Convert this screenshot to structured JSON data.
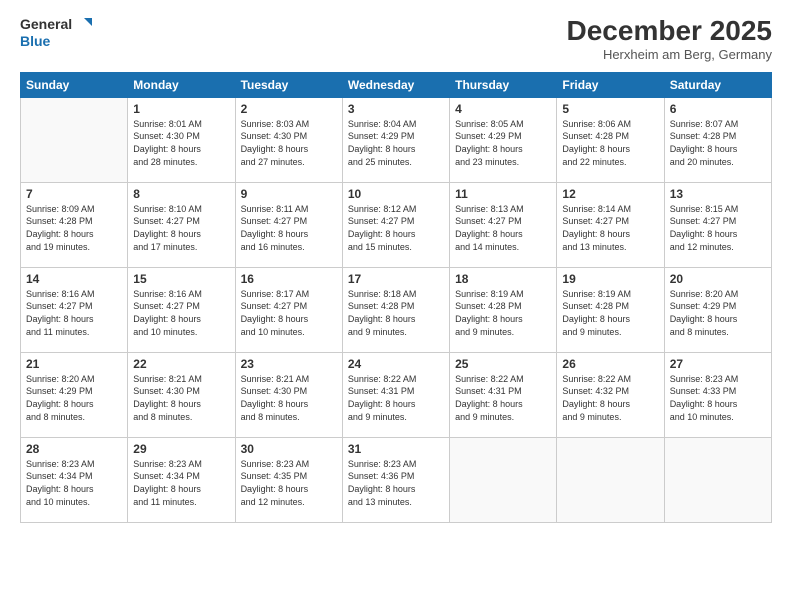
{
  "logo": {
    "general": "General",
    "blue": "Blue"
  },
  "title": "December 2025",
  "location": "Herxheim am Berg, Germany",
  "weekdays": [
    "Sunday",
    "Monday",
    "Tuesday",
    "Wednesday",
    "Thursday",
    "Friday",
    "Saturday"
  ],
  "weeks": [
    [
      {
        "day": "",
        "info": ""
      },
      {
        "day": "1",
        "info": "Sunrise: 8:01 AM\nSunset: 4:30 PM\nDaylight: 8 hours\nand 28 minutes."
      },
      {
        "day": "2",
        "info": "Sunrise: 8:03 AM\nSunset: 4:30 PM\nDaylight: 8 hours\nand 27 minutes."
      },
      {
        "day": "3",
        "info": "Sunrise: 8:04 AM\nSunset: 4:29 PM\nDaylight: 8 hours\nand 25 minutes."
      },
      {
        "day": "4",
        "info": "Sunrise: 8:05 AM\nSunset: 4:29 PM\nDaylight: 8 hours\nand 23 minutes."
      },
      {
        "day": "5",
        "info": "Sunrise: 8:06 AM\nSunset: 4:28 PM\nDaylight: 8 hours\nand 22 minutes."
      },
      {
        "day": "6",
        "info": "Sunrise: 8:07 AM\nSunset: 4:28 PM\nDaylight: 8 hours\nand 20 minutes."
      }
    ],
    [
      {
        "day": "7",
        "info": "Sunrise: 8:09 AM\nSunset: 4:28 PM\nDaylight: 8 hours\nand 19 minutes."
      },
      {
        "day": "8",
        "info": "Sunrise: 8:10 AM\nSunset: 4:27 PM\nDaylight: 8 hours\nand 17 minutes."
      },
      {
        "day": "9",
        "info": "Sunrise: 8:11 AM\nSunset: 4:27 PM\nDaylight: 8 hours\nand 16 minutes."
      },
      {
        "day": "10",
        "info": "Sunrise: 8:12 AM\nSunset: 4:27 PM\nDaylight: 8 hours\nand 15 minutes."
      },
      {
        "day": "11",
        "info": "Sunrise: 8:13 AM\nSunset: 4:27 PM\nDaylight: 8 hours\nand 14 minutes."
      },
      {
        "day": "12",
        "info": "Sunrise: 8:14 AM\nSunset: 4:27 PM\nDaylight: 8 hours\nand 13 minutes."
      },
      {
        "day": "13",
        "info": "Sunrise: 8:15 AM\nSunset: 4:27 PM\nDaylight: 8 hours\nand 12 minutes."
      }
    ],
    [
      {
        "day": "14",
        "info": "Sunrise: 8:16 AM\nSunset: 4:27 PM\nDaylight: 8 hours\nand 11 minutes."
      },
      {
        "day": "15",
        "info": "Sunrise: 8:16 AM\nSunset: 4:27 PM\nDaylight: 8 hours\nand 10 minutes."
      },
      {
        "day": "16",
        "info": "Sunrise: 8:17 AM\nSunset: 4:27 PM\nDaylight: 8 hours\nand 10 minutes."
      },
      {
        "day": "17",
        "info": "Sunrise: 8:18 AM\nSunset: 4:28 PM\nDaylight: 8 hours\nand 9 minutes."
      },
      {
        "day": "18",
        "info": "Sunrise: 8:19 AM\nSunset: 4:28 PM\nDaylight: 8 hours\nand 9 minutes."
      },
      {
        "day": "19",
        "info": "Sunrise: 8:19 AM\nSunset: 4:28 PM\nDaylight: 8 hours\nand 9 minutes."
      },
      {
        "day": "20",
        "info": "Sunrise: 8:20 AM\nSunset: 4:29 PM\nDaylight: 8 hours\nand 8 minutes."
      }
    ],
    [
      {
        "day": "21",
        "info": "Sunrise: 8:20 AM\nSunset: 4:29 PM\nDaylight: 8 hours\nand 8 minutes."
      },
      {
        "day": "22",
        "info": "Sunrise: 8:21 AM\nSunset: 4:30 PM\nDaylight: 8 hours\nand 8 minutes."
      },
      {
        "day": "23",
        "info": "Sunrise: 8:21 AM\nSunset: 4:30 PM\nDaylight: 8 hours\nand 8 minutes."
      },
      {
        "day": "24",
        "info": "Sunrise: 8:22 AM\nSunset: 4:31 PM\nDaylight: 8 hours\nand 9 minutes."
      },
      {
        "day": "25",
        "info": "Sunrise: 8:22 AM\nSunset: 4:31 PM\nDaylight: 8 hours\nand 9 minutes."
      },
      {
        "day": "26",
        "info": "Sunrise: 8:22 AM\nSunset: 4:32 PM\nDaylight: 8 hours\nand 9 minutes."
      },
      {
        "day": "27",
        "info": "Sunrise: 8:23 AM\nSunset: 4:33 PM\nDaylight: 8 hours\nand 10 minutes."
      }
    ],
    [
      {
        "day": "28",
        "info": "Sunrise: 8:23 AM\nSunset: 4:34 PM\nDaylight: 8 hours\nand 10 minutes."
      },
      {
        "day": "29",
        "info": "Sunrise: 8:23 AM\nSunset: 4:34 PM\nDaylight: 8 hours\nand 11 minutes."
      },
      {
        "day": "30",
        "info": "Sunrise: 8:23 AM\nSunset: 4:35 PM\nDaylight: 8 hours\nand 12 minutes."
      },
      {
        "day": "31",
        "info": "Sunrise: 8:23 AM\nSunset: 4:36 PM\nDaylight: 8 hours\nand 13 minutes."
      },
      {
        "day": "",
        "info": ""
      },
      {
        "day": "",
        "info": ""
      },
      {
        "day": "",
        "info": ""
      }
    ]
  ]
}
